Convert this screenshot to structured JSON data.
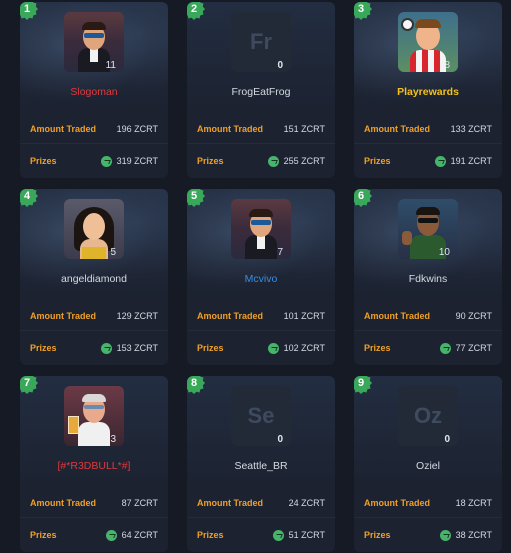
{
  "players": [
    {
      "rank": "1",
      "name": "Slogoman",
      "name_color": "red",
      "avatar": "suit-shades",
      "level": "11",
      "traded": "196 ZCRT",
      "prize": "319 ZCRT"
    },
    {
      "rank": "2",
      "name": "FrogEatFrog",
      "name_color": "default",
      "avatar": "initials",
      "initials": "Fr",
      "level": "0",
      "traded": "151 ZCRT",
      "prize": "255 ZCRT"
    },
    {
      "rank": "3",
      "name": "Playrewards",
      "name_color": "gold",
      "avatar": "soccer",
      "level": "8",
      "traded": "133 ZCRT",
      "prize": "191 ZCRT"
    },
    {
      "rank": "4",
      "name": "angeldiamond",
      "name_color": "default",
      "avatar": "woman",
      "level": "5",
      "traded": "129 ZCRT",
      "prize": "153 ZCRT"
    },
    {
      "rank": "5",
      "name": "Mcvivo",
      "name_color": "blue",
      "avatar": "suit-shades",
      "level": "7",
      "traded": "101 ZCRT",
      "prize": "102 ZCRT"
    },
    {
      "rank": "6",
      "name": "Fdkwins",
      "name_color": "default",
      "avatar": "thumbs-up",
      "level": "10",
      "traded": "90 ZCRT",
      "prize": "77 ZCRT"
    },
    {
      "rank": "7",
      "name": "[#*R3DBULL*#]",
      "name_color": "red",
      "avatar": "old-man-drink",
      "level": "3",
      "traded": "87 ZCRT",
      "prize": "64 ZCRT"
    },
    {
      "rank": "8",
      "name": "Seattle_BR",
      "name_color": "default",
      "avatar": "initials",
      "initials": "Se",
      "level": "0",
      "traded": "24 ZCRT",
      "prize": "51 ZCRT"
    },
    {
      "rank": "9",
      "name": "Oziel",
      "name_color": "default",
      "avatar": "initials",
      "initials": "Oz",
      "level": "0",
      "traded": "18 ZCRT",
      "prize": "38 ZCRT"
    }
  ],
  "labels": {
    "amount_traded": "Amount Traded",
    "prizes": "Prizes"
  },
  "colors": {
    "background": "#151a24",
    "card": "#1c2230",
    "label": "#f0a028",
    "rank_badge": "#3aa85a",
    "coin": "#46b46a",
    "name_red": "#e0393e",
    "name_gold": "#f2c21b",
    "name_blue": "#3d8bdc"
  },
  "icons": {
    "prize": "green-coin-icon"
  }
}
